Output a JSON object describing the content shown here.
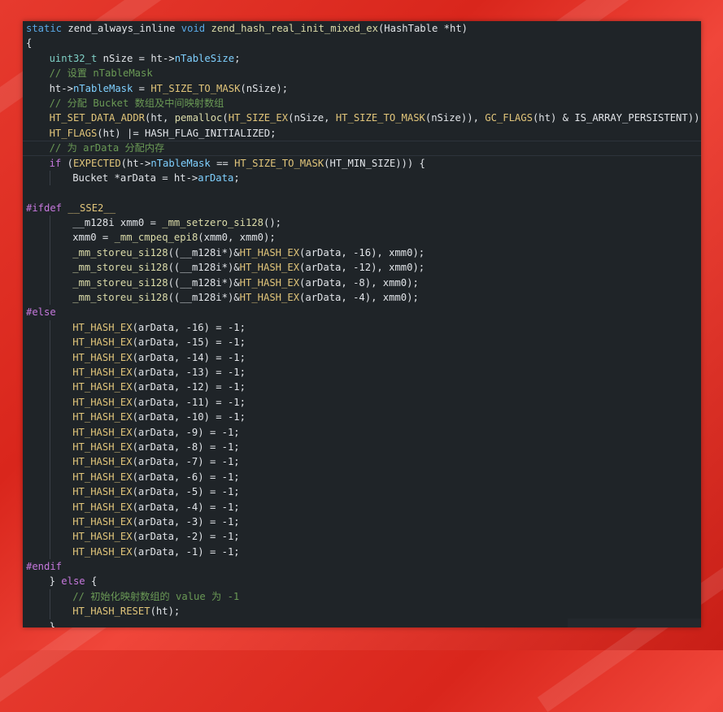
{
  "colors": {
    "background": "#e63a2e",
    "editor_bg": "#1f2428",
    "keyword": "#5aa9e6",
    "function": "#dcdcaa",
    "type": "#7fd0c6",
    "comment": "#6a9955",
    "preprocessor": "#c678dd",
    "field": "#7fd0ff",
    "text": "#e1e4e8"
  },
  "code": {
    "lines": [
      {
        "indent": 0,
        "tokens": [
          {
            "t": "static",
            "c": "kw"
          },
          {
            "t": " zend_always_inline ",
            "c": "tx"
          },
          {
            "t": "void",
            "c": "kw"
          },
          {
            "t": " ",
            "c": "tx"
          },
          {
            "t": "zend_hash_real_init_mixed_ex",
            "c": "fn"
          },
          {
            "t": "(HashTable *ht)",
            "c": "tx"
          }
        ]
      },
      {
        "indent": 0,
        "tokens": [
          {
            "t": "{",
            "c": "tx"
          }
        ]
      },
      {
        "indent": 1,
        "tokens": [
          {
            "t": "uint32_t",
            "c": "ty"
          },
          {
            "t": " nSize = ht->",
            "c": "tx"
          },
          {
            "t": "nTableSize",
            "c": "fd"
          },
          {
            "t": ";",
            "c": "tx"
          }
        ]
      },
      {
        "indent": 1,
        "tokens": [
          {
            "t": "// 设置 nTableMask",
            "c": "cm"
          }
        ]
      },
      {
        "indent": 1,
        "tokens": [
          {
            "t": "ht->",
            "c": "tx"
          },
          {
            "t": "nTableMask",
            "c": "fd"
          },
          {
            "t": " = ",
            "c": "tx"
          },
          {
            "t": "HT_SIZE_TO_MASK",
            "c": "mc"
          },
          {
            "t": "(nSize);",
            "c": "tx"
          }
        ]
      },
      {
        "indent": 1,
        "tokens": [
          {
            "t": "// 分配 Bucket 数组及中间映射数组",
            "c": "cm"
          }
        ]
      },
      {
        "indent": 1,
        "tokens": [
          {
            "t": "HT_SET_DATA_ADDR",
            "c": "mc"
          },
          {
            "t": "(ht, ",
            "c": "tx"
          },
          {
            "t": "pemalloc",
            "c": "fn"
          },
          {
            "t": "(",
            "c": "tx"
          },
          {
            "t": "HT_SIZE_EX",
            "c": "mc"
          },
          {
            "t": "(nSize, ",
            "c": "tx"
          },
          {
            "t": "HT_SIZE_TO_MASK",
            "c": "mc"
          },
          {
            "t": "(nSize)), ",
            "c": "tx"
          },
          {
            "t": "GC_FLAGS",
            "c": "mc"
          },
          {
            "t": "(ht) & IS_ARRAY_PERSISTENT));",
            "c": "tx"
          }
        ]
      },
      {
        "indent": 1,
        "tokens": [
          {
            "t": "HT_FLAGS",
            "c": "mc"
          },
          {
            "t": "(ht) |= HASH_FLAG_INITIALIZED;",
            "c": "tx"
          }
        ]
      },
      {
        "indent": 1,
        "current": true,
        "tokens": [
          {
            "t": "// 为 arData 分配内存",
            "c": "cm"
          }
        ]
      },
      {
        "indent": 1,
        "tokens": [
          {
            "t": "if",
            "c": "kw2"
          },
          {
            "t": " (",
            "c": "tx"
          },
          {
            "t": "EXPECTED",
            "c": "mc"
          },
          {
            "t": "(ht->",
            "c": "tx"
          },
          {
            "t": "nTableMask",
            "c": "fd"
          },
          {
            "t": " == ",
            "c": "tx"
          },
          {
            "t": "HT_SIZE_TO_MASK",
            "c": "mc"
          },
          {
            "t": "(HT_MIN_SIZE))) {",
            "c": "tx"
          }
        ]
      },
      {
        "indent": 2,
        "tokens": [
          {
            "t": "Bucket *arData = ht->",
            "c": "tx"
          },
          {
            "t": "arData",
            "c": "fd"
          },
          {
            "t": ";",
            "c": "tx"
          }
        ]
      },
      {
        "indent": 0,
        "tokens": [
          {
            "t": "",
            "c": "tx"
          }
        ]
      },
      {
        "indent": 0,
        "tokens": [
          {
            "t": "#ifdef",
            "c": "pp"
          },
          {
            "t": " __SSE2__",
            "c": "mc"
          }
        ]
      },
      {
        "indent": 2,
        "tokens": [
          {
            "t": "__m128i xmm0 = ",
            "c": "tx"
          },
          {
            "t": "_mm_setzero_si128",
            "c": "fn"
          },
          {
            "t": "();",
            "c": "tx"
          }
        ]
      },
      {
        "indent": 2,
        "tokens": [
          {
            "t": "xmm0 = ",
            "c": "tx"
          },
          {
            "t": "_mm_cmpeq_epi8",
            "c": "fn"
          },
          {
            "t": "(xmm0, xmm0);",
            "c": "tx"
          }
        ]
      },
      {
        "indent": 2,
        "tokens": [
          {
            "t": "_mm_storeu_si128",
            "c": "fn"
          },
          {
            "t": "((__m128i*)&",
            "c": "tx"
          },
          {
            "t": "HT_HASH_EX",
            "c": "mc"
          },
          {
            "t": "(arData, -16), xmm0);",
            "c": "tx"
          }
        ]
      },
      {
        "indent": 2,
        "tokens": [
          {
            "t": "_mm_storeu_si128",
            "c": "fn"
          },
          {
            "t": "((__m128i*)&",
            "c": "tx"
          },
          {
            "t": "HT_HASH_EX",
            "c": "mc"
          },
          {
            "t": "(arData, -12), xmm0);",
            "c": "tx"
          }
        ]
      },
      {
        "indent": 2,
        "tokens": [
          {
            "t": "_mm_storeu_si128",
            "c": "fn"
          },
          {
            "t": "((__m128i*)&",
            "c": "tx"
          },
          {
            "t": "HT_HASH_EX",
            "c": "mc"
          },
          {
            "t": "(arData, -8), xmm0);",
            "c": "tx"
          }
        ]
      },
      {
        "indent": 2,
        "tokens": [
          {
            "t": "_mm_storeu_si128",
            "c": "fn"
          },
          {
            "t": "((__m128i*)&",
            "c": "tx"
          },
          {
            "t": "HT_HASH_EX",
            "c": "mc"
          },
          {
            "t": "(arData, -4), xmm0);",
            "c": "tx"
          }
        ]
      },
      {
        "indent": 0,
        "tokens": [
          {
            "t": "#else",
            "c": "pp"
          }
        ]
      },
      {
        "indent": 2,
        "tokens": [
          {
            "t": "HT_HASH_EX",
            "c": "mc"
          },
          {
            "t": "(arData, -16) = -1;",
            "c": "tx"
          }
        ]
      },
      {
        "indent": 2,
        "tokens": [
          {
            "t": "HT_HASH_EX",
            "c": "mc"
          },
          {
            "t": "(arData, -15) = -1;",
            "c": "tx"
          }
        ]
      },
      {
        "indent": 2,
        "tokens": [
          {
            "t": "HT_HASH_EX",
            "c": "mc"
          },
          {
            "t": "(arData, -14) = -1;",
            "c": "tx"
          }
        ]
      },
      {
        "indent": 2,
        "tokens": [
          {
            "t": "HT_HASH_EX",
            "c": "mc"
          },
          {
            "t": "(arData, -13) = -1;",
            "c": "tx"
          }
        ]
      },
      {
        "indent": 2,
        "tokens": [
          {
            "t": "HT_HASH_EX",
            "c": "mc"
          },
          {
            "t": "(arData, -12) = -1;",
            "c": "tx"
          }
        ]
      },
      {
        "indent": 2,
        "tokens": [
          {
            "t": "HT_HASH_EX",
            "c": "mc"
          },
          {
            "t": "(arData, -11) = -1;",
            "c": "tx"
          }
        ]
      },
      {
        "indent": 2,
        "tokens": [
          {
            "t": "HT_HASH_EX",
            "c": "mc"
          },
          {
            "t": "(arData, -10) = -1;",
            "c": "tx"
          }
        ]
      },
      {
        "indent": 2,
        "tokens": [
          {
            "t": "HT_HASH_EX",
            "c": "mc"
          },
          {
            "t": "(arData, -9) = -1;",
            "c": "tx"
          }
        ]
      },
      {
        "indent": 2,
        "tokens": [
          {
            "t": "HT_HASH_EX",
            "c": "mc"
          },
          {
            "t": "(arData, -8) = -1;",
            "c": "tx"
          }
        ]
      },
      {
        "indent": 2,
        "tokens": [
          {
            "t": "HT_HASH_EX",
            "c": "mc"
          },
          {
            "t": "(arData, -7) = -1;",
            "c": "tx"
          }
        ]
      },
      {
        "indent": 2,
        "tokens": [
          {
            "t": "HT_HASH_EX",
            "c": "mc"
          },
          {
            "t": "(arData, -6) = -1;",
            "c": "tx"
          }
        ]
      },
      {
        "indent": 2,
        "tokens": [
          {
            "t": "HT_HASH_EX",
            "c": "mc"
          },
          {
            "t": "(arData, -5) = -1;",
            "c": "tx"
          }
        ]
      },
      {
        "indent": 2,
        "tokens": [
          {
            "t": "HT_HASH_EX",
            "c": "mc"
          },
          {
            "t": "(arData, -4) = -1;",
            "c": "tx"
          }
        ]
      },
      {
        "indent": 2,
        "tokens": [
          {
            "t": "HT_HASH_EX",
            "c": "mc"
          },
          {
            "t": "(arData, -3) = -1;",
            "c": "tx"
          }
        ]
      },
      {
        "indent": 2,
        "tokens": [
          {
            "t": "HT_HASH_EX",
            "c": "mc"
          },
          {
            "t": "(arData, -2) = -1;",
            "c": "tx"
          }
        ]
      },
      {
        "indent": 2,
        "tokens": [
          {
            "t": "HT_HASH_EX",
            "c": "mc"
          },
          {
            "t": "(arData, -1) = -1;",
            "c": "tx"
          }
        ]
      },
      {
        "indent": 0,
        "tokens": [
          {
            "t": "#endif",
            "c": "pp"
          }
        ]
      },
      {
        "indent": 1,
        "tokens": [
          {
            "t": "} ",
            "c": "tx"
          },
          {
            "t": "else",
            "c": "kw2"
          },
          {
            "t": " {",
            "c": "tx"
          }
        ]
      },
      {
        "indent": 2,
        "tokens": [
          {
            "t": "// 初始化映射数组的 value 为 -1",
            "c": "cm"
          }
        ]
      },
      {
        "indent": 2,
        "tokens": [
          {
            "t": "HT_HASH_RESET",
            "c": "mc"
          },
          {
            "t": "(ht);",
            "c": "tx"
          }
        ]
      },
      {
        "indent": 1,
        "tokens": [
          {
            "t": "}",
            "c": "tx"
          }
        ]
      }
    ]
  }
}
